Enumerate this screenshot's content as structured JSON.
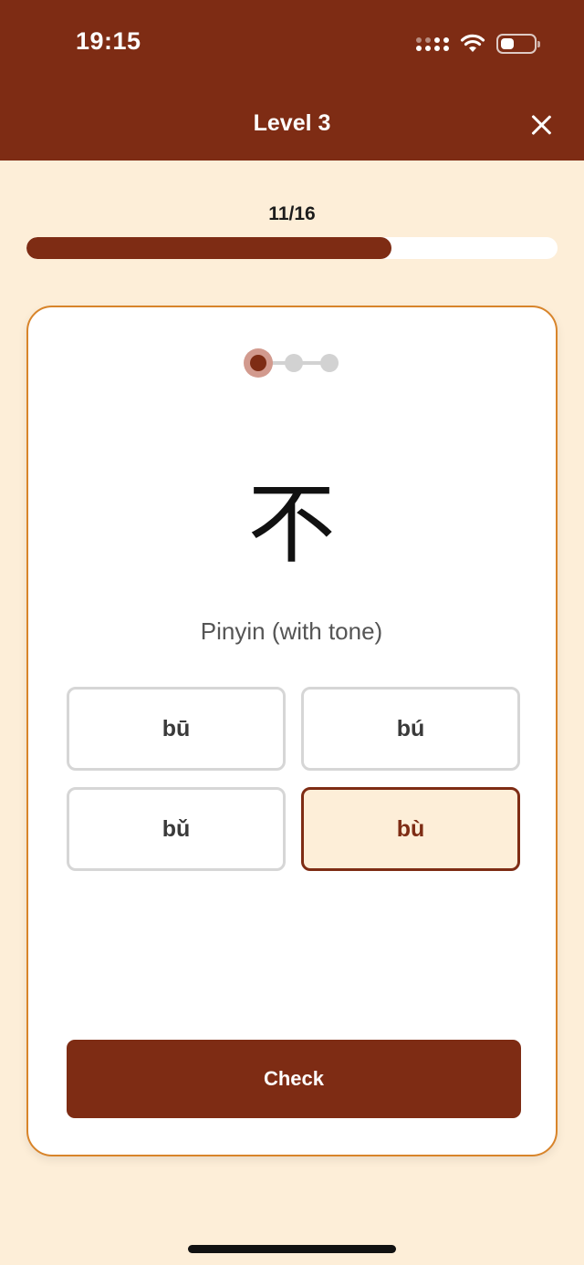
{
  "status_bar": {
    "time": "19:15",
    "icons": [
      "cellular-signal-icon",
      "wifi-icon",
      "battery-icon"
    ]
  },
  "header": {
    "title": "Level 3",
    "close_icon": "close-icon"
  },
  "progress": {
    "label": "11/16",
    "current": 11,
    "total": 16
  },
  "card": {
    "steps": {
      "count": 3,
      "active": 1
    },
    "character": "不",
    "prompt": "Pinyin (with tone)",
    "options": [
      {
        "label": "bū",
        "selected": false
      },
      {
        "label": "bú",
        "selected": false
      },
      {
        "label": "bǔ",
        "selected": false
      },
      {
        "label": "bù",
        "selected": true
      }
    ],
    "check_label": "Check"
  },
  "colors": {
    "brand": "#7E2C14",
    "background": "#FDEED8",
    "card_border": "#D8842A",
    "option_border": "#D6D6D6"
  }
}
